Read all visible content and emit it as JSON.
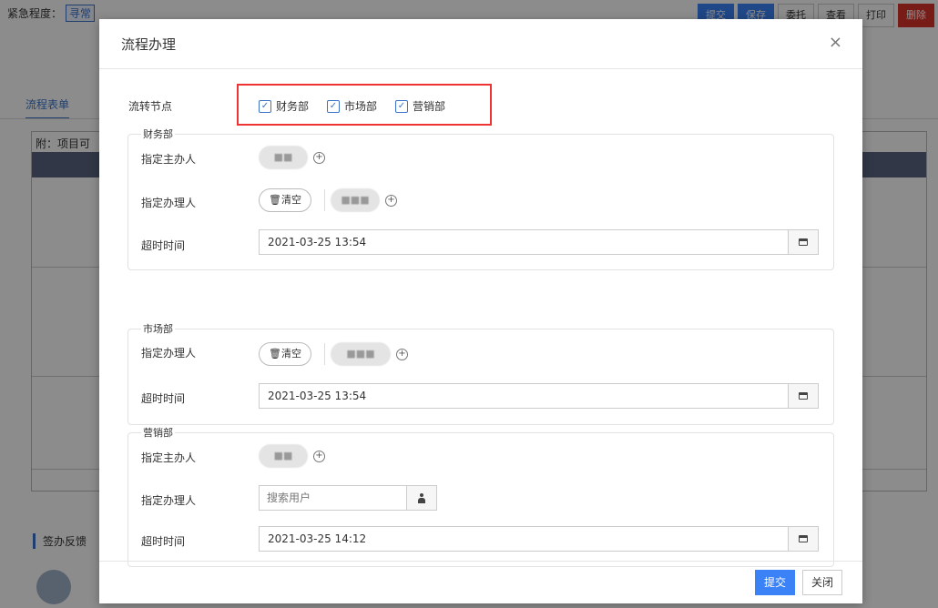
{
  "background": {
    "urgency_label": "紧急程度：",
    "urgency_value": "寻常",
    "toolbar": [
      "提交",
      "保存",
      "委托",
      "查看",
      "打印",
      "删除"
    ],
    "tab_label": "流程表单",
    "table_title": "附：项目可",
    "feedback_label": "签办反馈"
  },
  "modal": {
    "title": "流程办理",
    "close_glyph": "×",
    "node_label": "流转节点",
    "nodes": [
      {
        "label": "财务部",
        "checked": true
      },
      {
        "label": "市场部",
        "checked": true
      },
      {
        "label": "营销部",
        "checked": true
      }
    ],
    "check_glyph": "✓",
    "add_glyph": "+",
    "groups": {
      "finance": {
        "legend": "财务部",
        "main_handler_label": "指定主办人",
        "main_handler_name": "■■",
        "handler_label": "指定办理人",
        "clear_label": "清空",
        "handler_name": "■■■",
        "timeout_label": "超时时间",
        "timeout_value": "2021-03-25 13:54"
      },
      "market": {
        "legend": "市场部",
        "handler_label": "指定办理人",
        "clear_label": "清空",
        "handler_name": "■■■",
        "timeout_label": "超时时间",
        "timeout_value": "2021-03-25 13:54"
      },
      "sales": {
        "legend": "营销部",
        "main_handler_label": "指定主办人",
        "main_handler_name": "■■",
        "handler_label": "指定办理人",
        "search_placeholder": "搜索用户",
        "timeout_label": "超时时间",
        "timeout_value": "2021-03-25 14:12"
      }
    },
    "footer": {
      "submit_label": "提交",
      "close_label": "关闭"
    }
  },
  "colors": {
    "primary": "#3b82f6",
    "highlight_border": "#e33333",
    "checkbox": "#3b73c9"
  },
  "icons": [
    "close-icon",
    "checkbox-checked-icon",
    "plus-circle-icon",
    "trash-icon",
    "calendar-icon",
    "user-icon"
  ]
}
